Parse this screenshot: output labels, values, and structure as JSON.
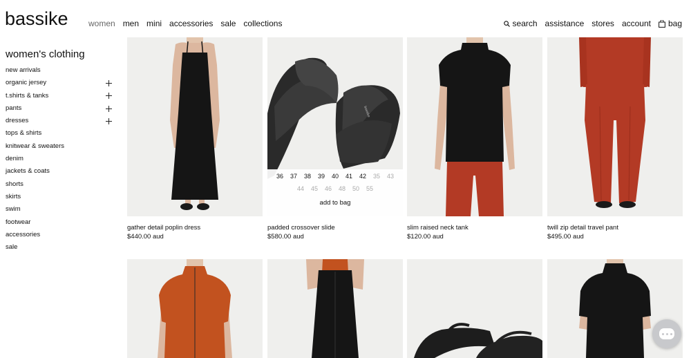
{
  "brand": {
    "logo_text": "bassike"
  },
  "main_nav": [
    {
      "label": "women",
      "active": true
    },
    {
      "label": "men"
    },
    {
      "label": "mini"
    },
    {
      "label": "accessories"
    },
    {
      "label": "sale"
    },
    {
      "label": "collections"
    }
  ],
  "util_nav": {
    "search": "search",
    "assistance": "assistance",
    "stores": "stores",
    "account": "account",
    "bag": "bag"
  },
  "sidebar": {
    "title": "women's clothing",
    "items": [
      {
        "label": "new arrivals",
        "expandable": false
      },
      {
        "label": "organic jersey",
        "expandable": true
      },
      {
        "label": "t.shirts & tanks",
        "expandable": true
      },
      {
        "label": "pants",
        "expandable": true
      },
      {
        "label": "dresses",
        "expandable": true
      },
      {
        "label": "tops & shirts",
        "expandable": false
      },
      {
        "label": "knitwear & sweaters",
        "expandable": false
      },
      {
        "label": "denim",
        "expandable": false
      },
      {
        "label": "jackets & coats",
        "expandable": false
      },
      {
        "label": "shorts",
        "expandable": false
      },
      {
        "label": "skirts",
        "expandable": false
      },
      {
        "label": "swim",
        "expandable": false
      },
      {
        "label": "footwear",
        "expandable": false
      },
      {
        "label": "accessories",
        "expandable": false
      },
      {
        "label": "sale",
        "expandable": false
      }
    ]
  },
  "products": [
    {
      "name": "gather detail poplin dress",
      "price": "$440.00 aud"
    },
    {
      "name": "padded crossover slide",
      "price": "$580.00 aud"
    },
    {
      "name": "slim raised neck tank",
      "price": "$120.00 aud"
    },
    {
      "name": "twill zip detail travel pant",
      "price": "$495.00 aud"
    }
  ],
  "size_panel": {
    "row1": [
      {
        "size": "36",
        "available": true
      },
      {
        "size": "37",
        "available": true
      },
      {
        "size": "38",
        "available": true
      },
      {
        "size": "39",
        "available": true
      },
      {
        "size": "40",
        "available": true
      },
      {
        "size": "41",
        "available": true
      },
      {
        "size": "42",
        "available": true
      },
      {
        "size": "35",
        "available": false
      },
      {
        "size": "43",
        "available": false
      }
    ],
    "row2": [
      {
        "size": "44",
        "available": false
      },
      {
        "size": "45",
        "available": false
      },
      {
        "size": "46",
        "available": false
      },
      {
        "size": "48",
        "available": false
      },
      {
        "size": "50",
        "available": false
      },
      {
        "size": "55",
        "available": false
      }
    ],
    "add_to_bag": "add to bag"
  },
  "colors": {
    "rust": "#b33a25",
    "orange": "#c2521f",
    "black": "#151515",
    "image_bg": "#efefed"
  }
}
